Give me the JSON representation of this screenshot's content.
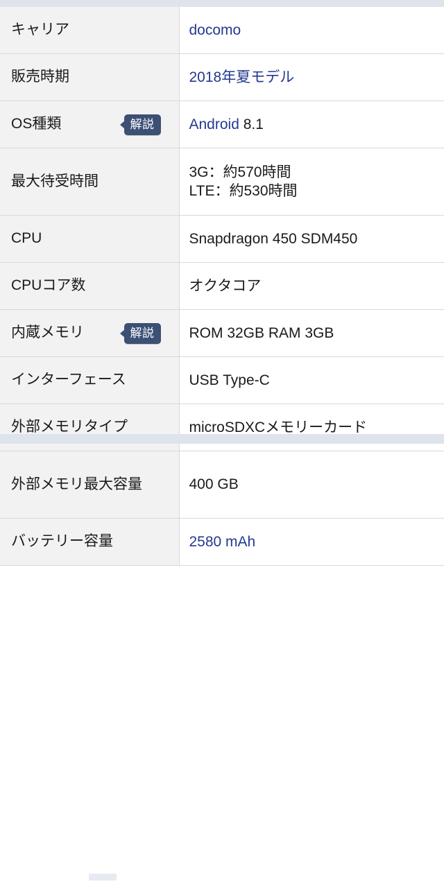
{
  "colors": {
    "link": "#23398f",
    "text": "#1a1a1a",
    "label_bg": "#f2f2f2",
    "value_bg": "#ffffff",
    "border": "#d8d8d8",
    "badge_bg": "#3c4f74",
    "chrome_band": "#dfe3ec"
  },
  "badge": {
    "label": "解説",
    "icon": "info-callout-icon"
  },
  "spec_table": {
    "rows": [
      {
        "label": "キャリア",
        "has_badge": false,
        "value_lines": [
          {
            "parts": [
              {
                "text": "docomo",
                "style": "link"
              }
            ]
          }
        ]
      },
      {
        "label": "販売時期",
        "has_badge": false,
        "value_lines": [
          {
            "parts": [
              {
                "text": "2018年夏モデル",
                "style": "link"
              }
            ]
          }
        ]
      },
      {
        "label": "OS種類",
        "has_badge": true,
        "value_lines": [
          {
            "parts": [
              {
                "text": "Android",
                "style": "link"
              },
              {
                "text": " 8.1",
                "style": "plain"
              }
            ]
          }
        ]
      },
      {
        "label": "最大待受時間",
        "has_badge": false,
        "tall": true,
        "value_lines": [
          {
            "parts": [
              {
                "text": "3G：約570時間",
                "style": "plain"
              }
            ]
          },
          {
            "parts": [
              {
                "text": "LTE：約530時間",
                "style": "plain"
              }
            ]
          }
        ]
      },
      {
        "label": "CPU",
        "has_badge": false,
        "value_lines": [
          {
            "parts": [
              {
                "text": "Snapdragon 450 SDM450",
                "style": "plain"
              }
            ]
          }
        ]
      },
      {
        "label": "CPUコア数",
        "has_badge": false,
        "value_lines": [
          {
            "parts": [
              {
                "text": "オクタコア",
                "style": "plain"
              }
            ]
          }
        ]
      },
      {
        "label": "内蔵メモリ",
        "has_badge": true,
        "value_lines": [
          {
            "parts": [
              {
                "text": "ROM 32GB RAM 3GB",
                "style": "plain"
              }
            ]
          }
        ]
      },
      {
        "label": "インターフェース",
        "has_badge": false,
        "value_lines": [
          {
            "parts": [
              {
                "text": "USB Type-C",
                "style": "plain"
              }
            ]
          }
        ]
      },
      {
        "label": "外部メモリタイプ",
        "has_badge": false,
        "value_lines": [
          {
            "parts": [
              {
                "text": "microSDXCメモリーカード",
                "style": "plain"
              }
            ]
          }
        ]
      },
      {
        "label": "外部メモリ最大容量",
        "has_badge": false,
        "tall": true,
        "value_lines": [
          {
            "parts": [
              {
                "text": "400 GB",
                "style": "plain"
              }
            ]
          }
        ]
      },
      {
        "label": "バッテリー容量",
        "has_badge": false,
        "value_lines": [
          {
            "parts": [
              {
                "text": "2580 mAh",
                "style": "link"
              }
            ]
          }
        ]
      }
    ]
  }
}
